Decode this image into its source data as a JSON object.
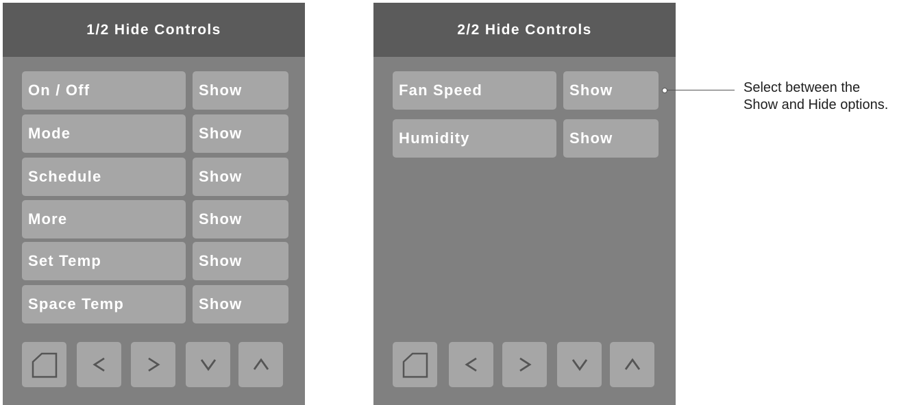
{
  "screens": [
    {
      "title": "1/2 Hide Controls",
      "rows": [
        {
          "label": "On / Off",
          "value": "Show"
        },
        {
          "label": "Mode",
          "value": "Show"
        },
        {
          "label": "Schedule",
          "value": "Show"
        },
        {
          "label": "More",
          "value": "Show"
        },
        {
          "label": "Set Temp",
          "value": "Show"
        },
        {
          "label": "Space Temp",
          "value": "Show"
        }
      ],
      "nav": {
        "home": "home-icon",
        "back": "<",
        "forward": ">",
        "down": "V",
        "up": "Λ"
      }
    },
    {
      "title": "2/2 Hide Controls",
      "rows": [
        {
          "label": "Fan Speed",
          "value": "Show"
        },
        {
          "label": "Humidity",
          "value": "Show"
        }
      ],
      "nav": {
        "home": "home-icon",
        "back": "<",
        "forward": ">",
        "down": "V",
        "up": "Λ"
      }
    }
  ],
  "callout": {
    "line1": "Select between the",
    "line2": "Show and Hide options."
  },
  "colors": {
    "screen_bg": "#808080",
    "titlebar_bg": "#5b5b5b",
    "button_bg": "#a6a6a6",
    "text": "#ffffff"
  }
}
